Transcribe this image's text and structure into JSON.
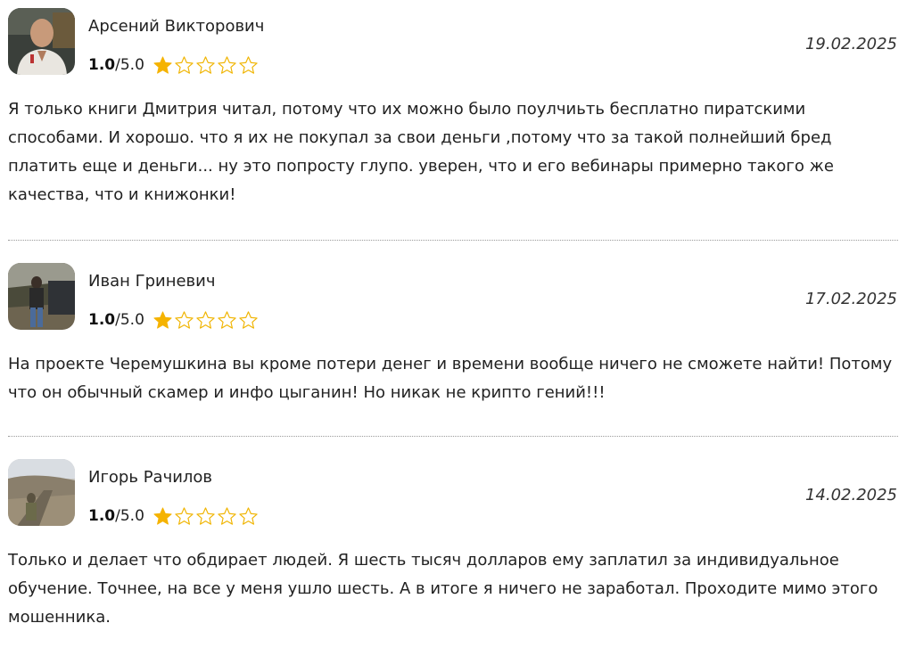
{
  "reviews": [
    {
      "author": "Арсений Викторович",
      "score": "1.0",
      "max": "/5.0",
      "rating_value": 1,
      "rating_total": 5,
      "date": "19.02.2025",
      "text": "Я только книги Дмитрия читал, потому что их можно было поулчиьть бесплатно пиратскими способами. И хорошо. что я их не покупал за свои деньги ,потому что за такой полнейший бред платить еще и деньги... ну это попросту глупо. уверен, что и его вебинары примерно такого же качества, что и книжонки!"
    },
    {
      "author": "Иван Гриневич",
      "score": "1.0",
      "max": "/5.0",
      "rating_value": 1,
      "rating_total": 5,
      "date": "17.02.2025",
      "text": "На проекте Черемушкина вы кроме потери денег и времени вообще ничего не сможете найти! Потому что он обычный скамер и инфо цыганин! Но никак не крипто гений!!!"
    },
    {
      "author": "Игорь Рачилов",
      "score": "1.0",
      "max": "/5.0",
      "rating_value": 1,
      "rating_total": 5,
      "date": "14.02.2025",
      "text": "Только и делает что обдирает людей. Я шесть тысяч долларов ему заплатил за индивидуальное обучение. Точнее, на все у меня ушло шесть. А в итоге я ничего не заработал. Проходите мимо этого мошенника."
    }
  ],
  "colors": {
    "star_filled": "#f5b301",
    "star_outline": "#f0b400",
    "divider": "#9a9a9a"
  },
  "icons": {
    "star": "star-icon"
  }
}
